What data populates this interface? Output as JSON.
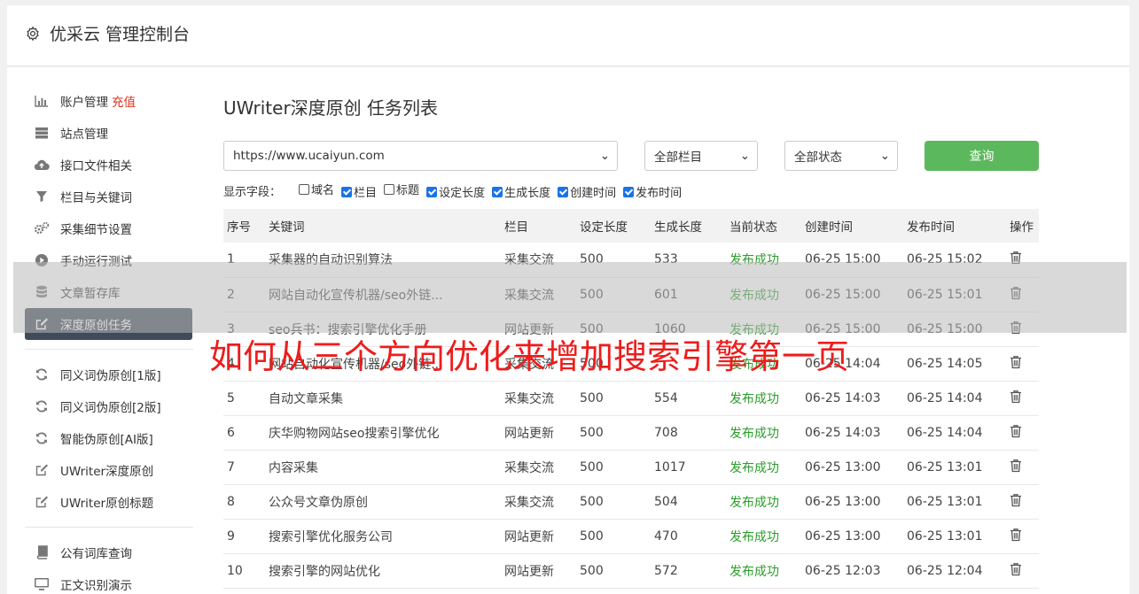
{
  "header": {
    "title": "优采云 管理控制台"
  },
  "sidebar": {
    "group1": [
      {
        "label": "账户管理",
        "badge": "充值",
        "icon": "bar-chart-icon"
      },
      {
        "label": "站点管理",
        "icon": "server-icon"
      },
      {
        "label": "接口文件相关",
        "icon": "cloud-upload-icon"
      },
      {
        "label": "栏目与关键词",
        "icon": "filter-icon"
      },
      {
        "label": "采集细节设置",
        "icon": "gears-icon"
      },
      {
        "label": "手动运行测试",
        "icon": "play-circle-icon"
      },
      {
        "label": "文章暂存库",
        "icon": "database-icon"
      },
      {
        "label": "深度原创任务",
        "icon": "edit-icon",
        "active": true
      }
    ],
    "group2": [
      {
        "label": "同义词伪原创[1版]",
        "icon": "refresh-icon"
      },
      {
        "label": "同义词伪原创[2版]",
        "icon": "refresh-icon"
      },
      {
        "label": "智能伪原创[AI版]",
        "icon": "refresh-icon"
      },
      {
        "label": "UWriter深度原创",
        "icon": "edit-icon"
      },
      {
        "label": "UWriter原创标题",
        "icon": "edit-icon"
      }
    ],
    "group3": [
      {
        "label": "公有词库查询",
        "icon": "book-icon"
      },
      {
        "label": "正文识别演示",
        "icon": "monitor-icon"
      }
    ]
  },
  "main": {
    "title": "UWriter深度原创 任务列表",
    "url_select": "https://www.ucaiyun.com",
    "column_select": "全部栏目",
    "status_select": "全部状态",
    "query_label": "查询",
    "fields_label": "显示字段：",
    "fields": [
      {
        "label": "域名",
        "checked": false
      },
      {
        "label": "栏目",
        "checked": true
      },
      {
        "label": "标题",
        "checked": false
      },
      {
        "label": "设定长度",
        "checked": true
      },
      {
        "label": "生成长度",
        "checked": true
      },
      {
        "label": "创建时间",
        "checked": true
      },
      {
        "label": "发布时间",
        "checked": true
      }
    ],
    "table": {
      "headers": [
        "序号",
        "关键词",
        "栏目",
        "设定长度",
        "生成长度",
        "当前状态",
        "创建时间",
        "发布时间",
        "操作"
      ],
      "rows": [
        [
          "1",
          "采集器的自动识别算法",
          "采集交流",
          "500",
          "533",
          "发布成功",
          "06-25 15:00",
          "06-25 15:02"
        ],
        [
          "2",
          "网站自动化宣传机器/seo外链...",
          "采集交流",
          "500",
          "601",
          "发布成功",
          "06-25 15:00",
          "06-25 15:01"
        ],
        [
          "3",
          "seo兵书：搜索引擎优化手册",
          "网站更新",
          "500",
          "1060",
          "发布成功",
          "06-25 15:00",
          "06-25 15:00"
        ],
        [
          "4",
          "网站自动化宣传机器/seo外链...",
          "采集交流",
          "500",
          "",
          "发布成功",
          "06-25 14:04",
          "06-25 14:05"
        ],
        [
          "5",
          "自动文章采集",
          "采集交流",
          "500",
          "554",
          "发布成功",
          "06-25 14:03",
          "06-25 14:04"
        ],
        [
          "6",
          "庆华购物网站seo搜索引擎优化",
          "网站更新",
          "500",
          "708",
          "发布成功",
          "06-25 14:03",
          "06-25 14:04"
        ],
        [
          "7",
          "内容采集",
          "采集交流",
          "500",
          "1017",
          "发布成功",
          "06-25 13:00",
          "06-25 13:01"
        ],
        [
          "8",
          "公众号文章伪原创",
          "采集交流",
          "500",
          "504",
          "发布成功",
          "06-25 13:00",
          "06-25 13:01"
        ],
        [
          "9",
          "搜索引擎优化服务公司",
          "网站更新",
          "500",
          "470",
          "发布成功",
          "06-25 13:00",
          "06-25 13:01"
        ],
        [
          "10",
          "搜索引擎的网站优化",
          "网站更新",
          "500",
          "572",
          "发布成功",
          "06-25 12:03",
          "06-25 12:04"
        ]
      ]
    }
  },
  "overlay": {
    "text": "如何从三个方向优化来增加搜索引擎第一页"
  },
  "colors": {
    "accent": "#5cb85c",
    "active_nav": "#3f4a5a",
    "success": "#2a9d2a",
    "overlay_text": "#ee1c1c"
  }
}
